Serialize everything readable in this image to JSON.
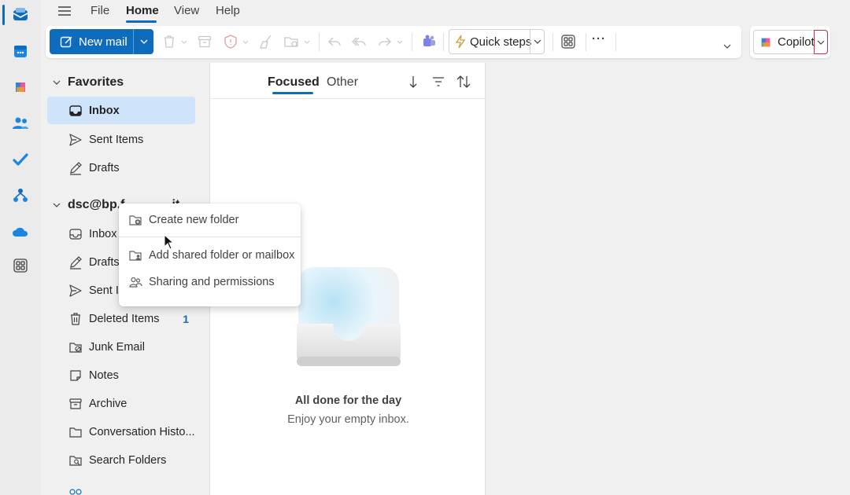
{
  "menu": {
    "tabs": [
      {
        "label": "File"
      },
      {
        "label": "Home"
      },
      {
        "label": "View"
      },
      {
        "label": "Help"
      }
    ],
    "active_tab": "Home"
  },
  "ribbon": {
    "new_mail_label": "New mail",
    "quick_steps_label": "Quick steps",
    "more_label": "···",
    "copilot_label": "Copilot"
  },
  "folders": {
    "favorites_label": "Favorites",
    "favorites": [
      {
        "label": "Inbox",
        "icon": "inbox-icon",
        "selected": true
      },
      {
        "label": "Sent Items",
        "icon": "send-icon"
      },
      {
        "label": "Drafts",
        "icon": "pencil-icon"
      }
    ],
    "account_label": "dsc@bp.f",
    "account_tail": "it",
    "account": [
      {
        "label": "Inbox",
        "icon": "inbox-icon"
      },
      {
        "label": "Drafts",
        "icon": "pencil-icon"
      },
      {
        "label": "Sent It",
        "icon": "send-icon"
      },
      {
        "label": "Deleted Items",
        "icon": "trash-icon",
        "count": "1"
      },
      {
        "label": "Junk Email",
        "icon": "junk-folder-icon"
      },
      {
        "label": "Notes",
        "icon": "note-icon"
      },
      {
        "label": "Archive",
        "icon": "archive-icon"
      },
      {
        "label": "Conversation Histo...",
        "icon": "folder-icon"
      },
      {
        "label": "Search Folders",
        "icon": "search-folder-icon"
      }
    ]
  },
  "list": {
    "pivots": [
      {
        "label": "Focused"
      },
      {
        "label": "Other"
      }
    ],
    "empty_title": "All done for the day",
    "empty_subtitle": "Enjoy your empty inbox."
  },
  "context_menu": {
    "items": [
      {
        "label": "Create new folder",
        "icon": "add-folder-icon"
      },
      {
        "label": "Add shared folder or mailbox",
        "icon": "shared-folder-icon"
      },
      {
        "label": "Sharing and permissions",
        "icon": "people-icon"
      }
    ]
  },
  "colors": {
    "accent": "#0f6cbd",
    "selected_bg": "#cfe4fa"
  }
}
